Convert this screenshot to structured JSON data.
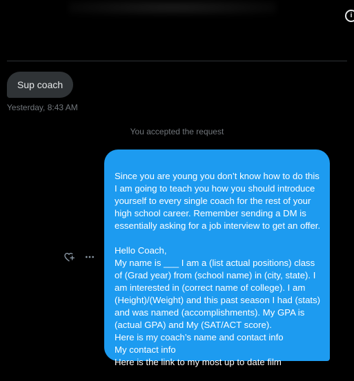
{
  "conversation": {
    "incoming_message": {
      "text": "Sup coach",
      "timestamp": "Yesterday, 8:43 AM"
    },
    "system_notice": "You accepted the request",
    "outgoing_message": {
      "text": "Since you are young you don’t know how to do this I am going to teach you how you should introduce yourself to every single coach for the rest of your high school career. Remember sending a DM is essentially asking for a job interview to get an offer.\n\nHello Coach,\nMy name is ___ I am a (list actual positions) class of (Grad year) from (school name) in (city, state). I am interested in (correct name of college). I am (Height)/(Weight) and this past season I had (stats) and was named (accomplishments). My GPA is (actual GPA) and My (SAT/ACT score).\nHere is my coach’s name and contact info\nMy contact info\nHere is the link to my most up to date film"
    }
  },
  "icons": {
    "info": "info-icon",
    "react": "add-reaction-icon",
    "more": "more-icon"
  },
  "colors": {
    "background": "#000000",
    "outgoing_bubble": "#1d9bf0",
    "incoming_bubble": "#2f3336",
    "muted_text": "#71767b"
  }
}
